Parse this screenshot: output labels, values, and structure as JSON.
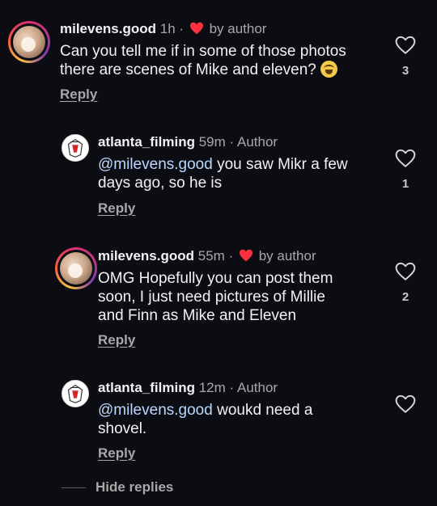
{
  "comments": [
    {
      "username": "milevens.good",
      "time": "1h",
      "separator": "·",
      "badge": "by author",
      "mention": "",
      "text_lines": [
        "Can you tell me if in some of those photos",
        "there are scenes of Mike and eleven?"
      ],
      "emoji": "loudly-crying-face",
      "reply_label": "Reply",
      "like_count": "3"
    },
    {
      "username": "atlanta_filming",
      "time": "59m",
      "separator": "·",
      "badge": "Author",
      "mention": "@milevens.good",
      "text_first": " you saw Mikr a few",
      "text_rest": "days ago, so he is",
      "reply_label": "Reply",
      "like_count": "1"
    },
    {
      "username": "milevens.good",
      "time": "55m",
      "separator": "·",
      "badge": "by author",
      "text_lines": [
        "OMG Hopefully you can post them",
        "soon, I just need pictures of Millie",
        "and Finn as Mike and Eleven"
      ],
      "reply_label": "Reply",
      "like_count": "2"
    },
    {
      "username": "atlanta_filming",
      "time": "12m",
      "separator": "·",
      "badge": "Author",
      "mention": "@milevens.good",
      "text_first": " woukd need a",
      "text_rest": "shovel.",
      "reply_label": "Reply",
      "like_count": ""
    }
  ],
  "hide_replies_label": "Hide replies",
  "colors": {
    "background": "#0b0d12",
    "text": "#f2f2f2",
    "muted": "#a8a8a8",
    "mention": "#b8d8ff",
    "heart": "#ff3040"
  },
  "icons": {
    "like": "heart-outline-icon",
    "creator_liked": "red-heart-icon"
  }
}
